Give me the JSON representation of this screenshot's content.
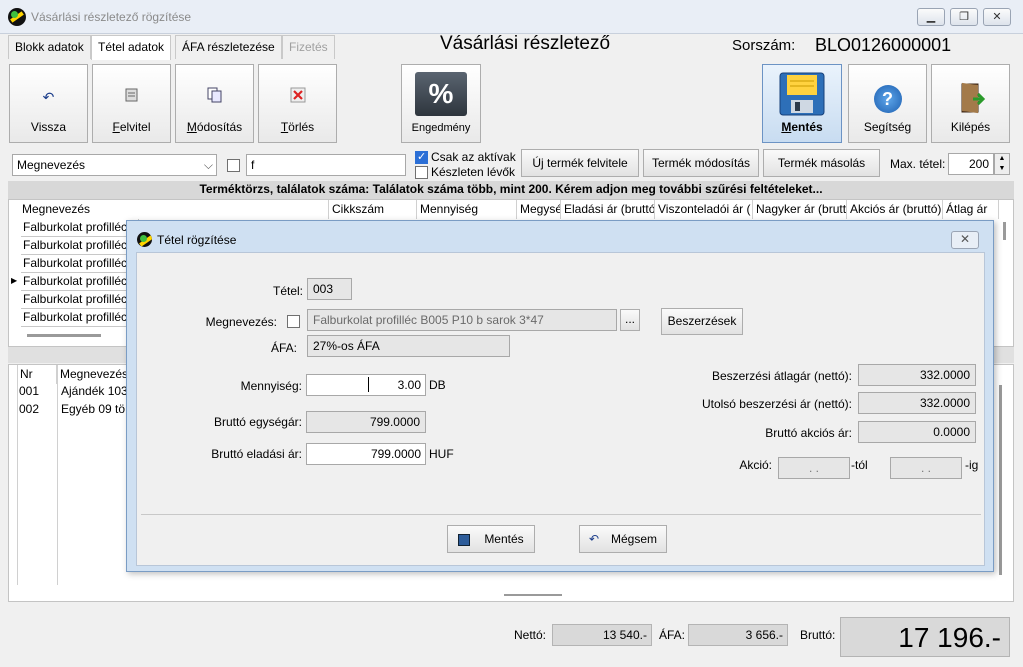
{
  "window": {
    "title": "Vásárlási részletező rögzítése",
    "min": "▁",
    "max": "❐",
    "close": "✕"
  },
  "tabs": [
    "Blokk adatok",
    "Tétel adatok",
    "ÁFA részletezése",
    "Fizetés"
  ],
  "header": {
    "title": "Vásárlási részletező",
    "serial_label": "Sorszám:",
    "serial_value": "BLO0126000001"
  },
  "toolbar": {
    "back": "Vissza",
    "add_u": "F",
    "add_rest": "elvitel",
    "modify_u": "M",
    "modify_rest": "ódosítás",
    "delete_u": "T",
    "delete_rest": "örlés",
    "discount": "Engedmény",
    "discount_icon": "%",
    "save_u": "M",
    "save_rest": "entés",
    "help": "Segítség",
    "exit": "Kilépés"
  },
  "filter": {
    "field": "Megnevezés",
    "value": "f",
    "only_active": "Csak az aktívak",
    "in_stock": "Készleten lévők",
    "new_product": "Új termék felvitele",
    "modify_product": "Termék módosítás",
    "copy_product": "Termék másolás",
    "max_label": "Max. tétel:",
    "max_value": "200"
  },
  "banner": "Terméktörzs, találatok száma: Találatok száma több, mint 200. Kérem adjon meg további szűrési feltételeket...",
  "product_grid": {
    "columns": [
      "Megnevezés",
      "Cikkszám",
      "Mennyiség",
      "Megysé",
      "Eladási ár (bruttó)",
      "Viszonteladói ár (",
      "Nagyker ár (bruttó",
      "Akciós ár (bruttó)",
      "Átlag ár"
    ],
    "rows": [
      "Falburkolat profillécr",
      "Falburkolat profillécr",
      "Falburkolat profillécr",
      "Falburkolat profillécr",
      "Falburkolat profillécr",
      "Falburkolat profillécr"
    ]
  },
  "item_grid": {
    "columns": [
      "Nr",
      "Megnevezés"
    ],
    "rows": [
      {
        "nr": "001",
        "name": "Ajándék 103"
      },
      {
        "nr": "002",
        "name": "Egyéb 09 tö"
      }
    ]
  },
  "footer": {
    "net_label": "Nettó:",
    "net": "13 540.-",
    "vat_label": "ÁFA:",
    "vat": "3 656.-",
    "gross_label": "Bruttó:",
    "gross": "17 196.-"
  },
  "dialog": {
    "title": "Tétel rögzítése",
    "item_label": "Tétel:",
    "item_value": "003",
    "name_label": "Megnevezés:",
    "name_value": "Falburkolat profilléc B005 P10 b sarok 3*47",
    "browse": "...",
    "purchases_btn": "Beszerzések",
    "vat_label": "ÁFA:",
    "vat_value": "27%-os ÁFA",
    "qty_label": "Mennyiség:",
    "qty_value": "3.00",
    "qty_unit": "DB",
    "unit_price_label": "Bruttó egységár:",
    "unit_price": "799.0000",
    "sale_price_label": "Bruttó eladási ár:",
    "sale_price": "799.0000",
    "currency": "HUF",
    "avg_label": "Beszerzési átlagár (nettó):",
    "avg_value": "332.0000",
    "last_label": "Utolsó beszerzési ár (nettó):",
    "last_value": "332.0000",
    "promo_label": "Bruttó akciós ár:",
    "promo_value": "0.0000",
    "action_label": "Akció:",
    "date_from": ". .",
    "from_suffix": "-tól",
    "date_to": ". .",
    "to_suffix": "-ig",
    "save": "Mentés",
    "cancel": "Mégsem"
  }
}
